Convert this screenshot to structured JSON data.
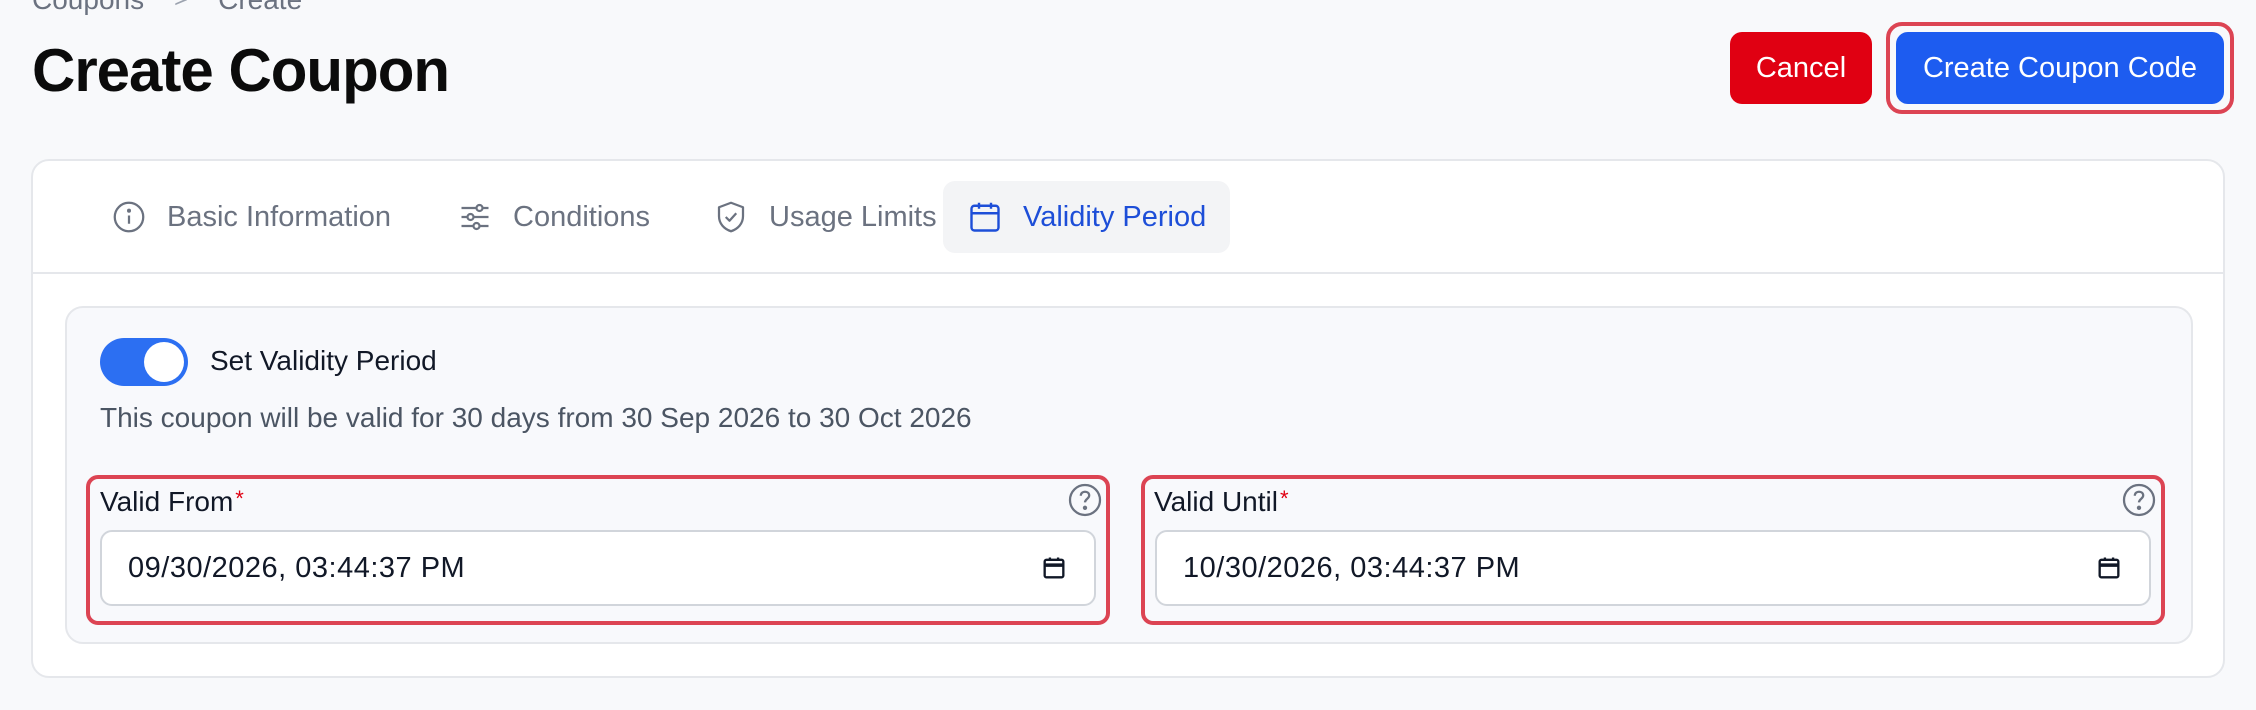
{
  "breadcrumb": {
    "parent": "Coupons",
    "separator": ">",
    "current": "Create"
  },
  "page_title": "Create Coupon",
  "actions": {
    "cancel_label": "Cancel",
    "create_label": "Create Coupon Code"
  },
  "tabs": [
    {
      "label": "Basic Information",
      "icon": "info-circle-icon"
    },
    {
      "label": "Conditions",
      "icon": "sliders-icon"
    },
    {
      "label": "Usage Limits",
      "icon": "shield-check-icon"
    },
    {
      "label": "Validity Period",
      "icon": "calendar-icon",
      "active": true
    }
  ],
  "validity": {
    "toggle_label": "Set Validity Period",
    "toggle_on": true,
    "summary": "This coupon will be valid for 30 days from 30 Sep 2026 to 30 Oct 2026",
    "valid_from": {
      "label": "Valid From",
      "required_mark": "*",
      "value": "09/30/2026, 03:44:37 PM"
    },
    "valid_until": {
      "label": "Valid Until",
      "required_mark": "*",
      "value": "10/30/2026, 03:44:37 PM"
    }
  },
  "colors": {
    "primary": "#1d5cf0",
    "danger": "#e00012",
    "highlight": "#dc4453",
    "active_tab_text": "#1d4ed8"
  }
}
